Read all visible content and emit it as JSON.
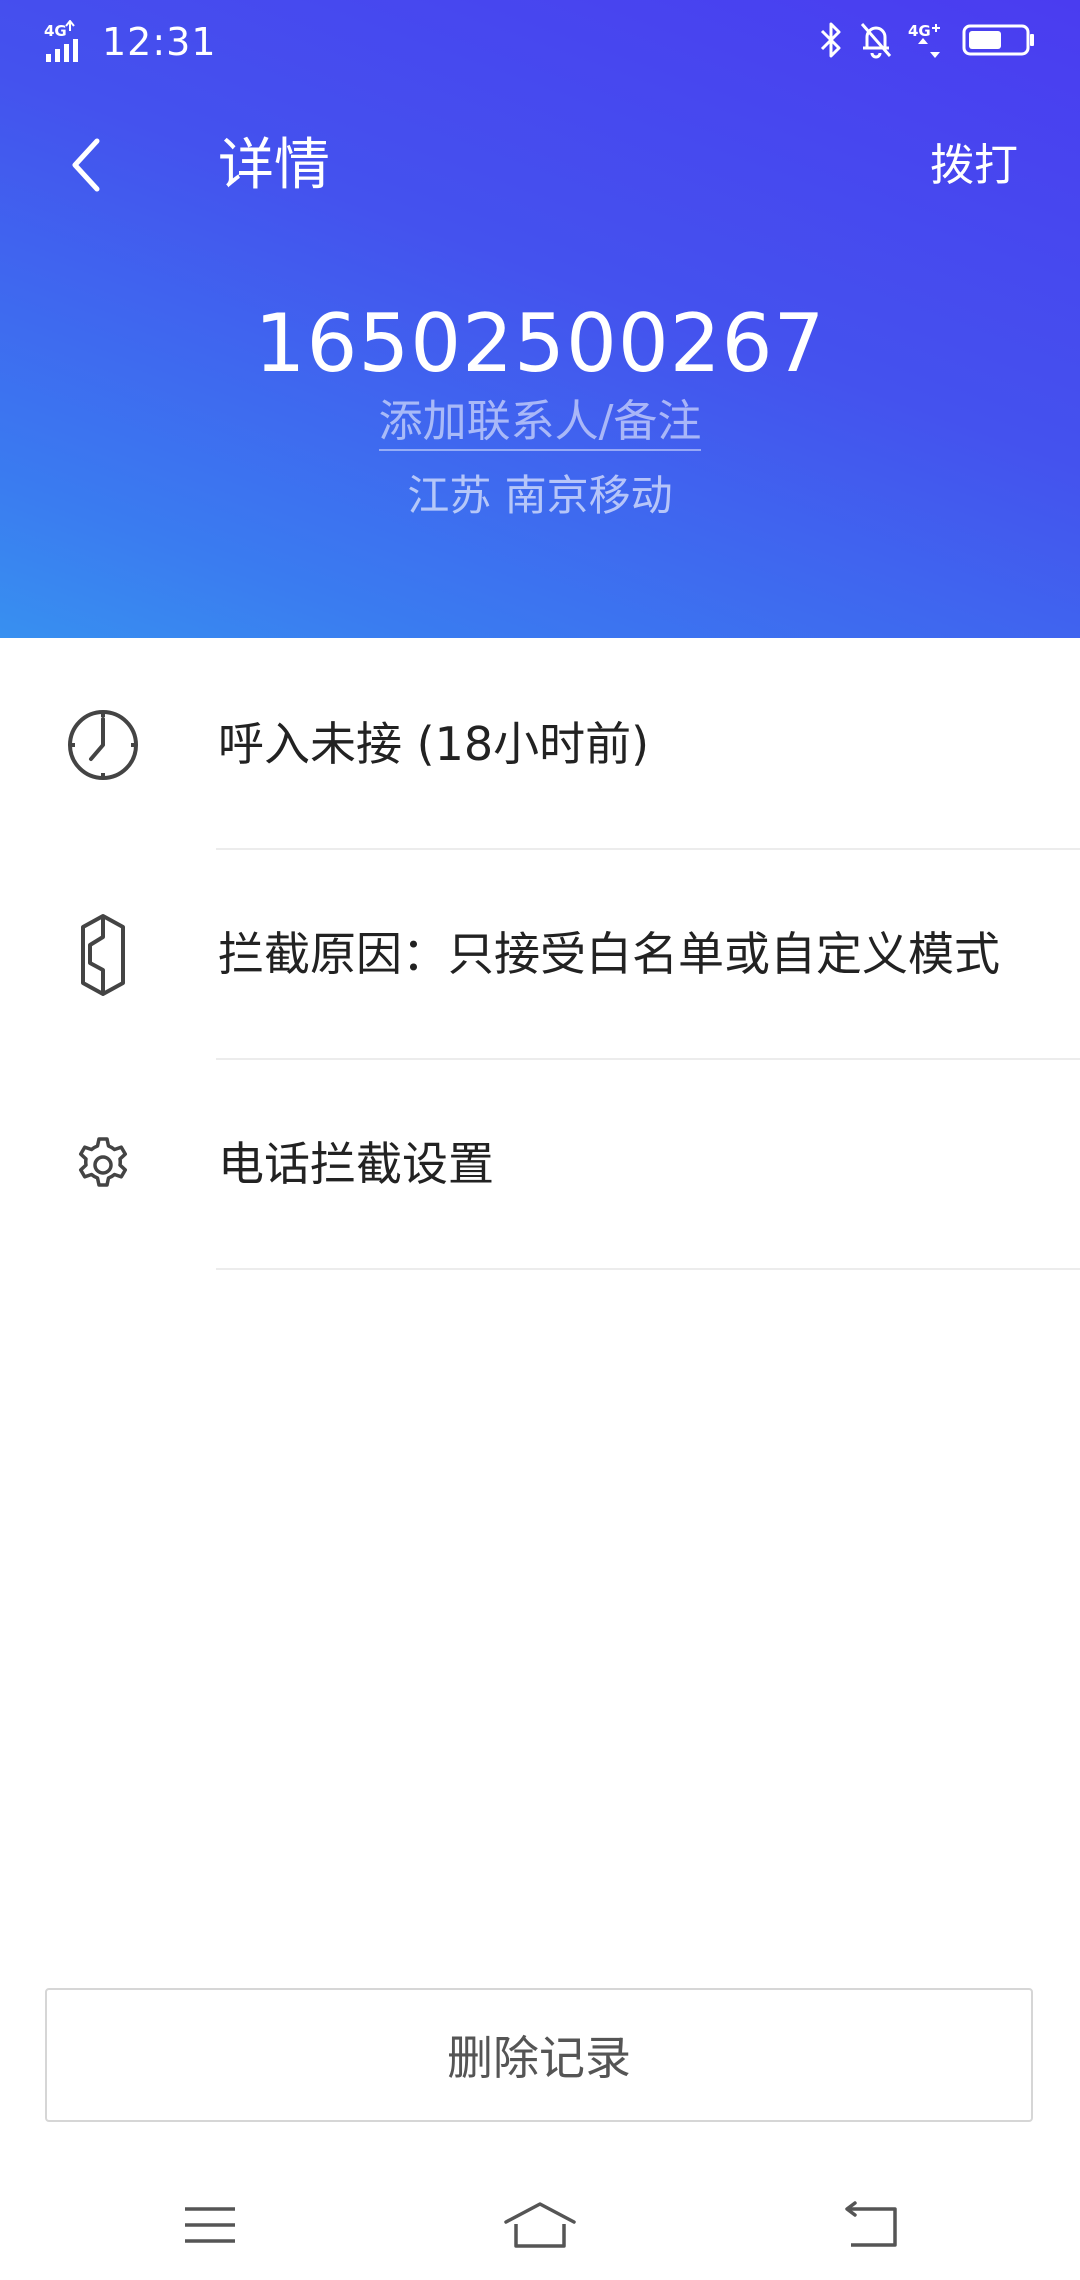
{
  "status_bar": {
    "time": "12:31",
    "network_left": "4G",
    "network_right": "4G"
  },
  "header": {
    "title": "详情",
    "dial_label": "拨打",
    "phone_number": "16502500267",
    "add_contact_label": "添加联系人/备注",
    "location": "江苏 南京移动",
    "gradient_colors": [
      "#4a3cf0",
      "#3890f0"
    ]
  },
  "details": {
    "items": [
      {
        "icon": "clock-icon",
        "label": "呼入未接  (18小时前)"
      },
      {
        "icon": "block-shield-icon",
        "label": "拦截原因：只接受白名单或自定义模式"
      },
      {
        "icon": "gear-icon",
        "label": "电话拦截设置"
      }
    ]
  },
  "actions": {
    "delete_label": "删除记录"
  },
  "nav": {
    "menu": "menu-icon",
    "home": "home-icon",
    "back": "back-icon"
  }
}
